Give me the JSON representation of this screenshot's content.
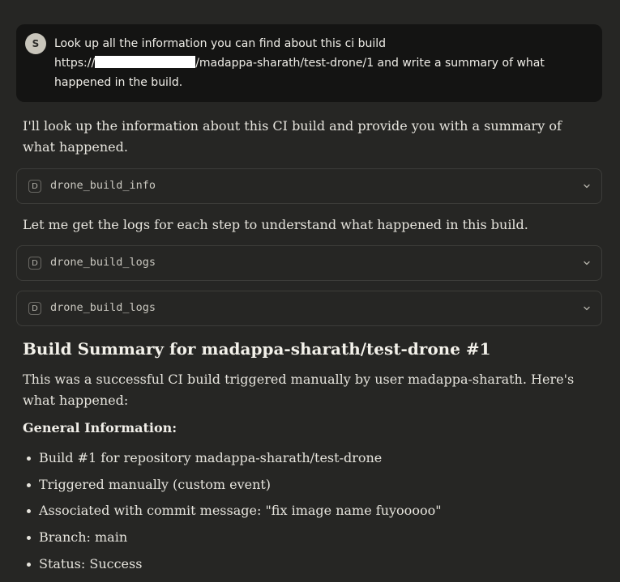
{
  "user_message": {
    "avatar_initial": "S",
    "line1": "Look up all the information you can find about this ci build",
    "line2_prefix": "https://",
    "line2_suffix": "/madappa-sharath/test-drone/1 and write a summary of what",
    "line3": "happened in the build."
  },
  "intro_text": "I'll look up the information about this CI build and provide you with a summary of what happened.",
  "tool_calls": [
    {
      "badge": "D",
      "name": "drone_build_info"
    },
    {
      "badge": "D",
      "name": "drone_build_logs"
    },
    {
      "badge": "D",
      "name": "drone_build_logs"
    }
  ],
  "logs_text": "Let me get the logs for each step to understand what happened in this build.",
  "summary": {
    "heading": "Build Summary for madappa-sharath/test-drone #1",
    "intro": "This was a successful CI build triggered manually by user madappa-sharath. Here's what happened:",
    "general_heading": "General Information:",
    "bullets": [
      "Build #1 for repository madappa-sharath/test-drone",
      "Triggered manually (custom event)",
      "Associated with commit message: \"fix image name fuyooooo\"",
      "Branch: main",
      "Status: Success"
    ]
  },
  "colors": {
    "background": "#262624",
    "user_bubble": "#141413",
    "border": "#3d3d3a",
    "text": "#e6e4dd"
  },
  "icons": {
    "tool_expand": "chevron-down-icon"
  }
}
